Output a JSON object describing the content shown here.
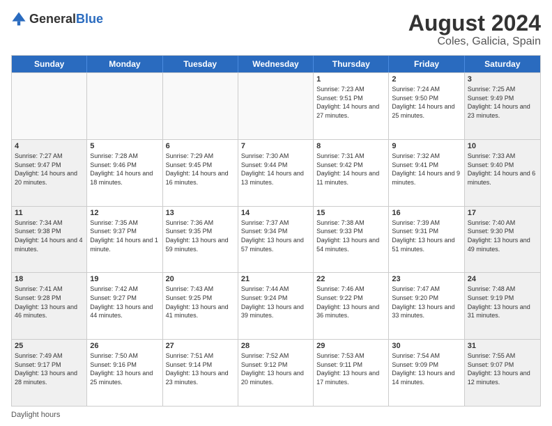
{
  "logo": {
    "general": "General",
    "blue": "Blue"
  },
  "title": "August 2024",
  "subtitle": "Coles, Galicia, Spain",
  "days": [
    "Sunday",
    "Monday",
    "Tuesday",
    "Wednesday",
    "Thursday",
    "Friday",
    "Saturday"
  ],
  "footer_text": "Daylight hours",
  "weeks": [
    [
      {
        "num": "",
        "text": "",
        "empty": true
      },
      {
        "num": "",
        "text": "",
        "empty": true
      },
      {
        "num": "",
        "text": "",
        "empty": true
      },
      {
        "num": "",
        "text": "",
        "empty": true
      },
      {
        "num": "1",
        "text": "Sunrise: 7:23 AM\nSunset: 9:51 PM\nDaylight: 14 hours and 27 minutes.",
        "empty": false
      },
      {
        "num": "2",
        "text": "Sunrise: 7:24 AM\nSunset: 9:50 PM\nDaylight: 14 hours and 25 minutes.",
        "empty": false
      },
      {
        "num": "3",
        "text": "Sunrise: 7:25 AM\nSunset: 9:49 PM\nDaylight: 14 hours and 23 minutes.",
        "empty": false
      }
    ],
    [
      {
        "num": "4",
        "text": "Sunrise: 7:27 AM\nSunset: 9:47 PM\nDaylight: 14 hours and 20 minutes.",
        "empty": false
      },
      {
        "num": "5",
        "text": "Sunrise: 7:28 AM\nSunset: 9:46 PM\nDaylight: 14 hours and 18 minutes.",
        "empty": false
      },
      {
        "num": "6",
        "text": "Sunrise: 7:29 AM\nSunset: 9:45 PM\nDaylight: 14 hours and 16 minutes.",
        "empty": false
      },
      {
        "num": "7",
        "text": "Sunrise: 7:30 AM\nSunset: 9:44 PM\nDaylight: 14 hours and 13 minutes.",
        "empty": false
      },
      {
        "num": "8",
        "text": "Sunrise: 7:31 AM\nSunset: 9:42 PM\nDaylight: 14 hours and 11 minutes.",
        "empty": false
      },
      {
        "num": "9",
        "text": "Sunrise: 7:32 AM\nSunset: 9:41 PM\nDaylight: 14 hours and 9 minutes.",
        "empty": false
      },
      {
        "num": "10",
        "text": "Sunrise: 7:33 AM\nSunset: 9:40 PM\nDaylight: 14 hours and 6 minutes.",
        "empty": false
      }
    ],
    [
      {
        "num": "11",
        "text": "Sunrise: 7:34 AM\nSunset: 9:38 PM\nDaylight: 14 hours and 4 minutes.",
        "empty": false
      },
      {
        "num": "12",
        "text": "Sunrise: 7:35 AM\nSunset: 9:37 PM\nDaylight: 14 hours and 1 minute.",
        "empty": false
      },
      {
        "num": "13",
        "text": "Sunrise: 7:36 AM\nSunset: 9:35 PM\nDaylight: 13 hours and 59 minutes.",
        "empty": false
      },
      {
        "num": "14",
        "text": "Sunrise: 7:37 AM\nSunset: 9:34 PM\nDaylight: 13 hours and 57 minutes.",
        "empty": false
      },
      {
        "num": "15",
        "text": "Sunrise: 7:38 AM\nSunset: 9:33 PM\nDaylight: 13 hours and 54 minutes.",
        "empty": false
      },
      {
        "num": "16",
        "text": "Sunrise: 7:39 AM\nSunset: 9:31 PM\nDaylight: 13 hours and 51 minutes.",
        "empty": false
      },
      {
        "num": "17",
        "text": "Sunrise: 7:40 AM\nSunset: 9:30 PM\nDaylight: 13 hours and 49 minutes.",
        "empty": false
      }
    ],
    [
      {
        "num": "18",
        "text": "Sunrise: 7:41 AM\nSunset: 9:28 PM\nDaylight: 13 hours and 46 minutes.",
        "empty": false
      },
      {
        "num": "19",
        "text": "Sunrise: 7:42 AM\nSunset: 9:27 PM\nDaylight: 13 hours and 44 minutes.",
        "empty": false
      },
      {
        "num": "20",
        "text": "Sunrise: 7:43 AM\nSunset: 9:25 PM\nDaylight: 13 hours and 41 minutes.",
        "empty": false
      },
      {
        "num": "21",
        "text": "Sunrise: 7:44 AM\nSunset: 9:24 PM\nDaylight: 13 hours and 39 minutes.",
        "empty": false
      },
      {
        "num": "22",
        "text": "Sunrise: 7:46 AM\nSunset: 9:22 PM\nDaylight: 13 hours and 36 minutes.",
        "empty": false
      },
      {
        "num": "23",
        "text": "Sunrise: 7:47 AM\nSunset: 9:20 PM\nDaylight: 13 hours and 33 minutes.",
        "empty": false
      },
      {
        "num": "24",
        "text": "Sunrise: 7:48 AM\nSunset: 9:19 PM\nDaylight: 13 hours and 31 minutes.",
        "empty": false
      }
    ],
    [
      {
        "num": "25",
        "text": "Sunrise: 7:49 AM\nSunset: 9:17 PM\nDaylight: 13 hours and 28 minutes.",
        "empty": false
      },
      {
        "num": "26",
        "text": "Sunrise: 7:50 AM\nSunset: 9:16 PM\nDaylight: 13 hours and 25 minutes.",
        "empty": false
      },
      {
        "num": "27",
        "text": "Sunrise: 7:51 AM\nSunset: 9:14 PM\nDaylight: 13 hours and 23 minutes.",
        "empty": false
      },
      {
        "num": "28",
        "text": "Sunrise: 7:52 AM\nSunset: 9:12 PM\nDaylight: 13 hours and 20 minutes.",
        "empty": false
      },
      {
        "num": "29",
        "text": "Sunrise: 7:53 AM\nSunset: 9:11 PM\nDaylight: 13 hours and 17 minutes.",
        "empty": false
      },
      {
        "num": "30",
        "text": "Sunrise: 7:54 AM\nSunset: 9:09 PM\nDaylight: 13 hours and 14 minutes.",
        "empty": false
      },
      {
        "num": "31",
        "text": "Sunrise: 7:55 AM\nSunset: 9:07 PM\nDaylight: 13 hours and 12 minutes.",
        "empty": false
      }
    ]
  ]
}
